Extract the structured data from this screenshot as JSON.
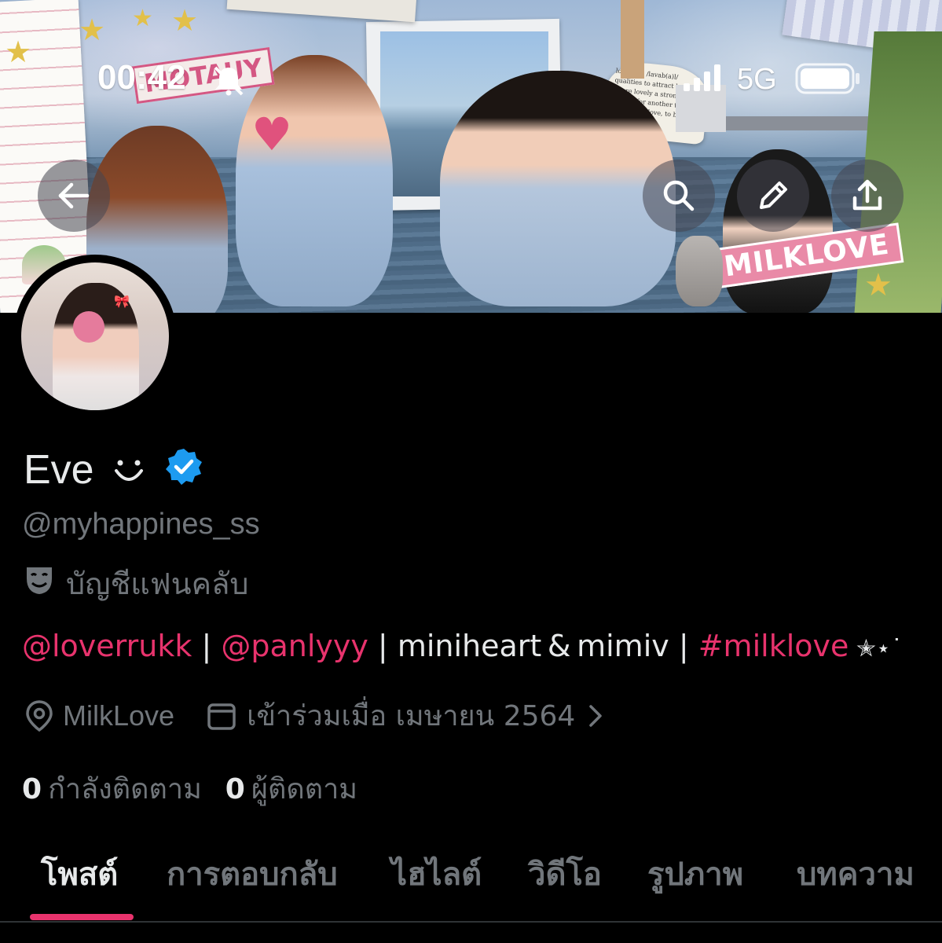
{
  "status_bar": {
    "time": "00:42",
    "network": "5G"
  },
  "banner": {
    "sticker_left": "MOTAUY",
    "sticker_right": "MILKLOVE",
    "note_text": "love-able /lavab(a)l/ qualities to attract love adore lovely a strong feeling for another to be a passionate love, to be in"
  },
  "header_buttons": {
    "back_icon": "arrow-left-icon",
    "search_icon": "search-icon",
    "edit_icon": "pencil-icon",
    "share_icon": "share-icon"
  },
  "profile": {
    "name": "Eve",
    "name_emoji": "◡̈",
    "handle": "@myhappines_ss",
    "fan_label": "บัญชีแฟนคลับ",
    "bio": {
      "mention1": "@loverrukk",
      "sep1": " | ",
      "mention2": "@panlyyy",
      "sep2": " | ",
      "plain": "miniheart & mimiv",
      "sep3": " | ",
      "hashtag": "#milklove",
      "tail": " ✭⋆˙"
    },
    "location": "MilkLove",
    "joined": "เข้าร่วมเมื่อ เมษายน 2564",
    "following_count": "0",
    "following_label": "กำลังติดตาม",
    "followers_count": "0",
    "followers_label": "ผู้ติดตาม"
  },
  "tabs": [
    {
      "label": "โพสต์",
      "active": true
    },
    {
      "label": "การตอบกลับ",
      "active": false
    },
    {
      "label": "ไฮไลต์",
      "active": false
    },
    {
      "label": "วิดีโอ",
      "active": false
    },
    {
      "label": "รูปภาพ",
      "active": false
    },
    {
      "label": "บทความ",
      "active": false
    }
  ],
  "colors": {
    "accent": "#e8336d",
    "verified": "#1d9bf0",
    "muted": "#71767b",
    "text": "#e7e9ea",
    "background": "#000000"
  }
}
